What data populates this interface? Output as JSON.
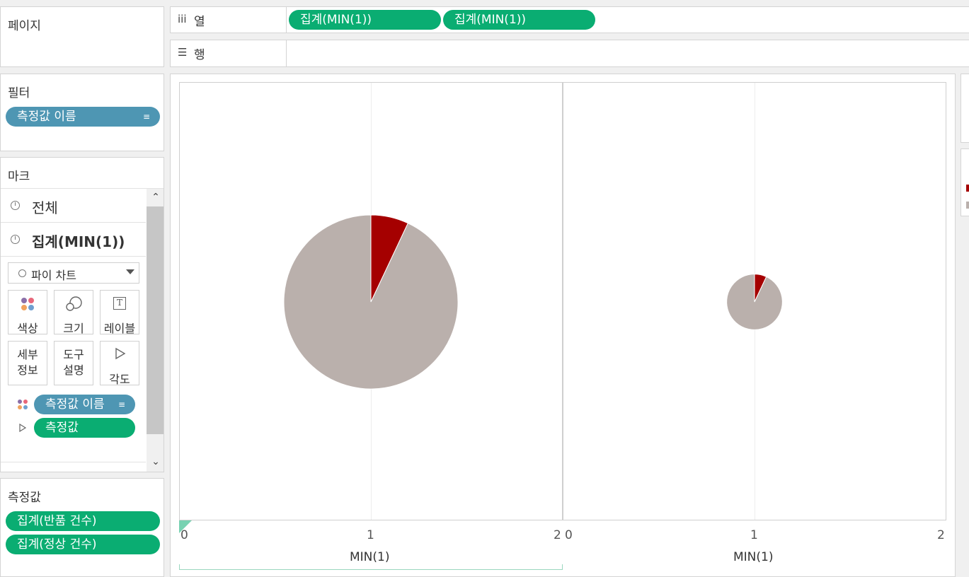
{
  "pages_card": {
    "title": "페이지"
  },
  "filters_card": {
    "title": "필터",
    "pills": [
      "측정값 이름"
    ]
  },
  "marks_card": {
    "title": "마크",
    "rows": [
      {
        "label": "전체",
        "bold": false
      },
      {
        "label": "집계(MIN(1))",
        "bold": true
      }
    ],
    "mark_type": "파이 차트",
    "buttons": {
      "color": "색상",
      "size": "크기",
      "label": "레이블",
      "detail_line1": "세부",
      "detail_line2": "정보",
      "tooltip_line1": "도구",
      "tooltip_line2": "설명",
      "angle": "각도"
    },
    "fields": [
      {
        "icon": "color-dots-icon",
        "label": "측정값 이름",
        "sort": true
      },
      {
        "icon": "angle-icon",
        "label": "측정값",
        "sort": false
      }
    ]
  },
  "measures_card": {
    "title": "측정값",
    "pills": [
      "집계(반품 건수)",
      "집계(정상 건수)"
    ]
  },
  "shelves": {
    "columns": {
      "label": "열",
      "icon": "iii",
      "pills": [
        "집계(MIN(1))",
        "집계(MIN(1))"
      ]
    },
    "rows": {
      "label": "행",
      "icon": "list-icon"
    }
  },
  "colors": {
    "pill_green": "#0aad72",
    "pill_blue": "#4e96b3",
    "slice_return": "#a50000",
    "slice_normal": "#bab0ac"
  },
  "chart_data": [
    {
      "type": "pie",
      "x_value": 1,
      "xlim": [
        0,
        2
      ],
      "xticks": [
        "0",
        "1",
        "2"
      ],
      "xlabel": "MIN(1)",
      "slices": [
        {
          "name": "집계(반품 건수)",
          "fraction": 0.07,
          "color": "#a50000"
        },
        {
          "name": "집계(정상 건수)",
          "fraction": 0.93,
          "color": "#bab0ac"
        }
      ],
      "relative_size": 1.0
    },
    {
      "type": "pie",
      "x_value": 1,
      "xlim": [
        0,
        2
      ],
      "xticks": [
        "0",
        "1",
        "2"
      ],
      "xlabel": "MIN(1)",
      "slices": [
        {
          "name": "집계(반품 건수)",
          "fraction": 0.07,
          "color": "#a50000"
        },
        {
          "name": "집계(정상 건수)",
          "fraction": 0.93,
          "color": "#bab0ac"
        }
      ],
      "relative_size": 0.32
    }
  ]
}
